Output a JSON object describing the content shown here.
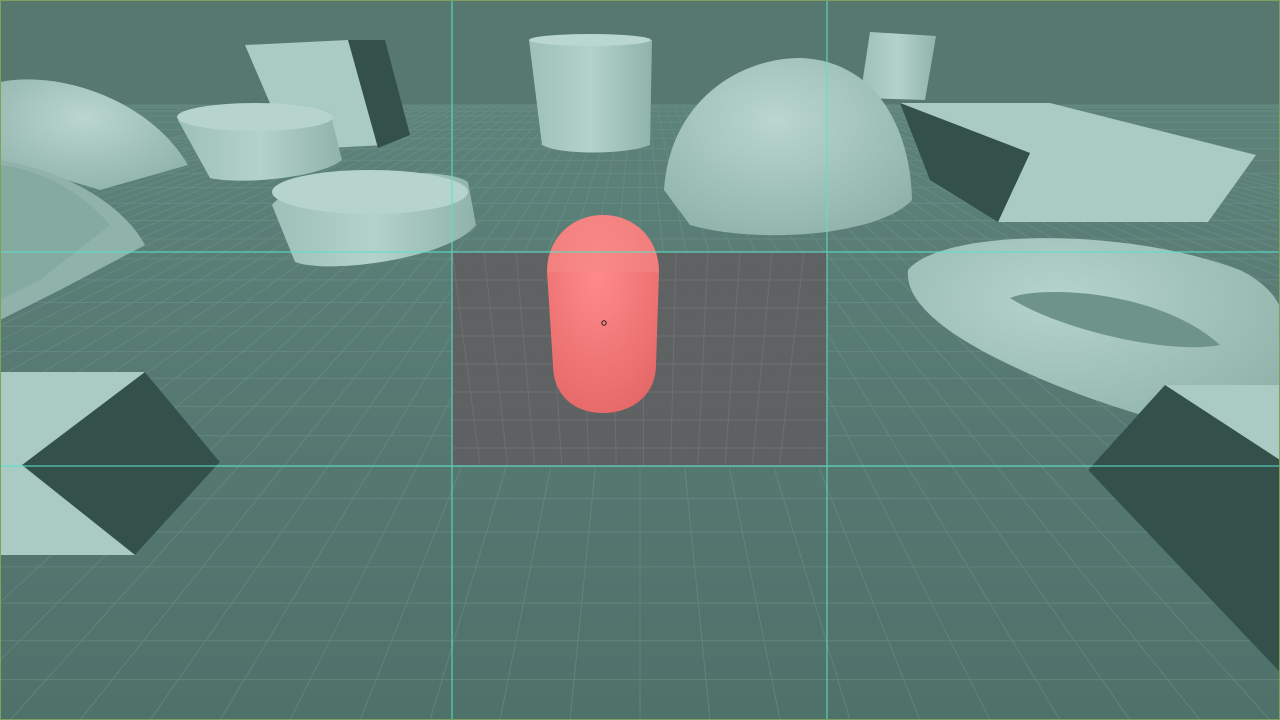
{
  "viewport": {
    "name": "3d-viewport",
    "overlay": "rule-of-thirds-guides",
    "colors": {
      "background": "#4f6e67",
      "floor": "#557a72",
      "grid_line": "#6a8f86",
      "guide_line": "#5ee0c8",
      "tint_overlay": "#5a7f77",
      "object_light": "#a9cbc3",
      "object_mid": "#8fb3aa",
      "object_dark": "#33504a",
      "capsule": "#f07070",
      "center_region": "#606062"
    }
  },
  "scene": {
    "selected_object": "capsule",
    "objects": [
      "dome",
      "cylinder",
      "cube",
      "torus",
      "wedge",
      "capsule"
    ]
  }
}
